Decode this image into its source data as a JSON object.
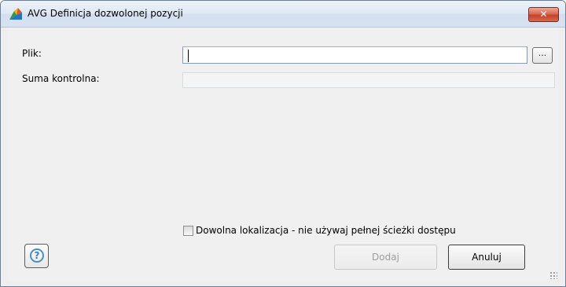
{
  "window": {
    "title": "AVG Definicja dozwolonej pozycji",
    "close_label": "✕",
    "app_icon": "avg-logo-icon"
  },
  "form": {
    "file_label": "Plik:",
    "file_value": "",
    "browse_label": "...",
    "checksum_label": "Suma kontrolna:",
    "checksum_value": ""
  },
  "options": {
    "any_location_label": "Dowolna lokalizacja - nie używaj pełnej ścieżki dostępu",
    "any_location_checked": false
  },
  "buttons": {
    "help_icon": "question-mark-icon",
    "help_glyph": "?",
    "add_label": "Dodaj",
    "cancel_label": "Anuluj"
  },
  "colors": {
    "accent_blue": "#4d8fc4",
    "close_red": "#c6422b"
  }
}
